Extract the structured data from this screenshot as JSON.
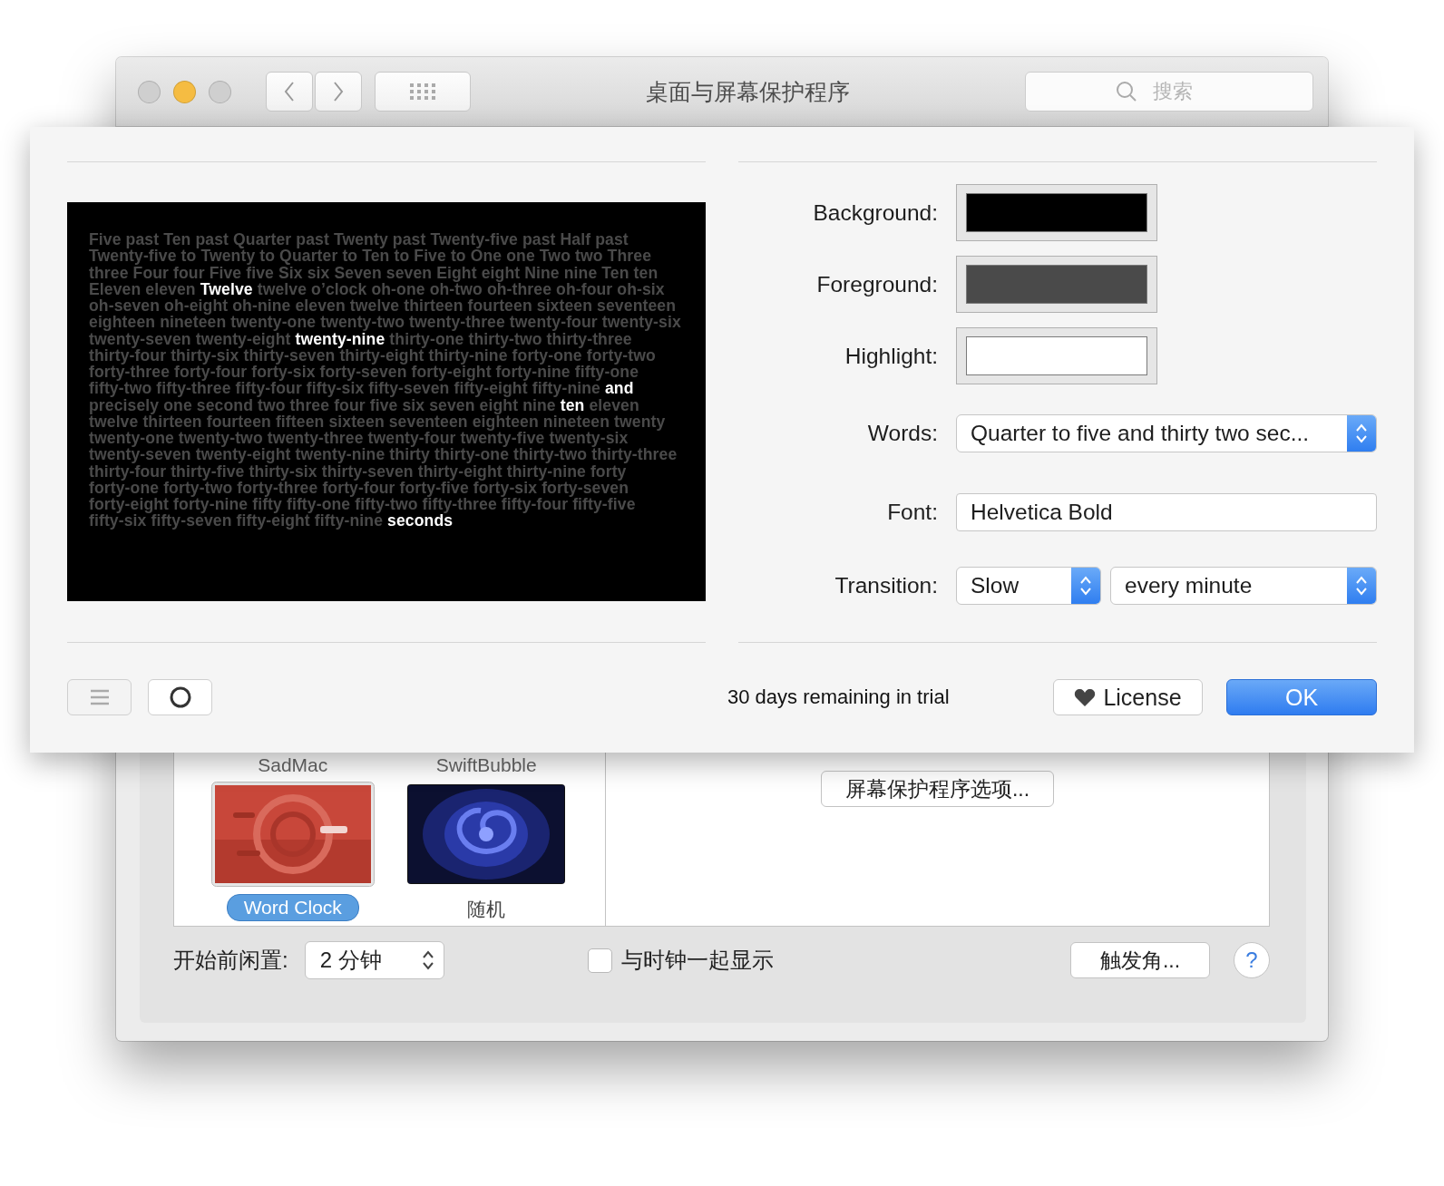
{
  "window": {
    "title": "桌面与屏幕保护程序",
    "search": {
      "placeholder": "搜索"
    }
  },
  "sheet": {
    "colors": [
      {
        "label": "Background:",
        "color": "#000000"
      },
      {
        "label": "Foreground:",
        "color": "#4a4a4a"
      },
      {
        "label": "Highlight:",
        "color": "#ffffff"
      }
    ],
    "words": {
      "label": "Words:",
      "value": "Quarter to five and thirty two sec..."
    },
    "font": {
      "label": "Font:",
      "value": "Helvetica Bold"
    },
    "transition": {
      "label": "Transition:",
      "speed": "Slow",
      "interval": "every minute"
    },
    "preview": {
      "segments": [
        {
          "text": "Five past Ten past Quarter past Twenty past Twenty-five past Half past Twenty-five to Twenty to Quarter to Ten to Five to One one Two two Three three Four four Five five Six six Seven seven Eight eight Nine nine Ten ten Eleven eleven",
          "highlighted": false
        },
        {
          "text": "Twelve",
          "highlighted": true
        },
        {
          "text": "twelve o’clock oh-one oh-two oh-three oh-four oh-six oh-seven oh-eight oh-nine eleven twelve thirteen fourteen sixteen seventeen eighteen nineteen twenty-one twenty-two twenty-three twenty-four twenty-six twenty-seven twenty-eight",
          "highlighted": false
        },
        {
          "text": "twenty-nine",
          "highlighted": true
        },
        {
          "text": "thirty-one thirty-two thirty-three thirty-four thirty-six thirty-seven thirty-eight thirty-nine forty-one forty-two forty-three forty-four forty-six forty-seven forty-eight forty-nine fifty-one fifty-two fifty-three fifty-four fifty-six fifty-seven fifty-eight fifty-nine",
          "highlighted": false
        },
        {
          "text": "and",
          "highlighted": true
        },
        {
          "text": "precisely one second two three four five six seven eight nine",
          "highlighted": false
        },
        {
          "text": "ten",
          "highlighted": true
        },
        {
          "text": "eleven twelve thirteen fourteen fifteen sixteen seventeen eighteen nineteen twenty twenty-one twenty-two twenty-three twenty-four twenty-five twenty-six twenty-seven twenty-eight twenty-nine thirty thirty-one thirty-two thirty-three thirty-four thirty-five thirty-six thirty-seven thirty-eight thirty-nine forty forty-one forty-two forty-three forty-four forty-five forty-six forty-seven forty-eight forty-nine fifty fifty-one fifty-two fifty-three fifty-four fifty-five fifty-six fifty-seven fifty-eight fifty-nine",
          "highlighted": false
        },
        {
          "text": "seconds",
          "highlighted": true
        }
      ]
    },
    "trial": "30 days remaining in trial",
    "license_button": "License",
    "ok_button": "OK"
  },
  "screen_savers": {
    "above": [
      "SadMac",
      "SwiftBubble"
    ],
    "items": [
      {
        "name": "Word Clock",
        "selected": true,
        "kind": "picture"
      },
      {
        "name": "随机",
        "selected": false,
        "kind": "picture"
      }
    ]
  },
  "options_button": "屏幕保护程序选项...",
  "idle": {
    "label": "开始前闲置:",
    "value": "2 分钟"
  },
  "show_clock": {
    "label": "与时钟一起显示",
    "checked": false
  },
  "hot_corners_button": "触发角...",
  "help_button": "?"
}
